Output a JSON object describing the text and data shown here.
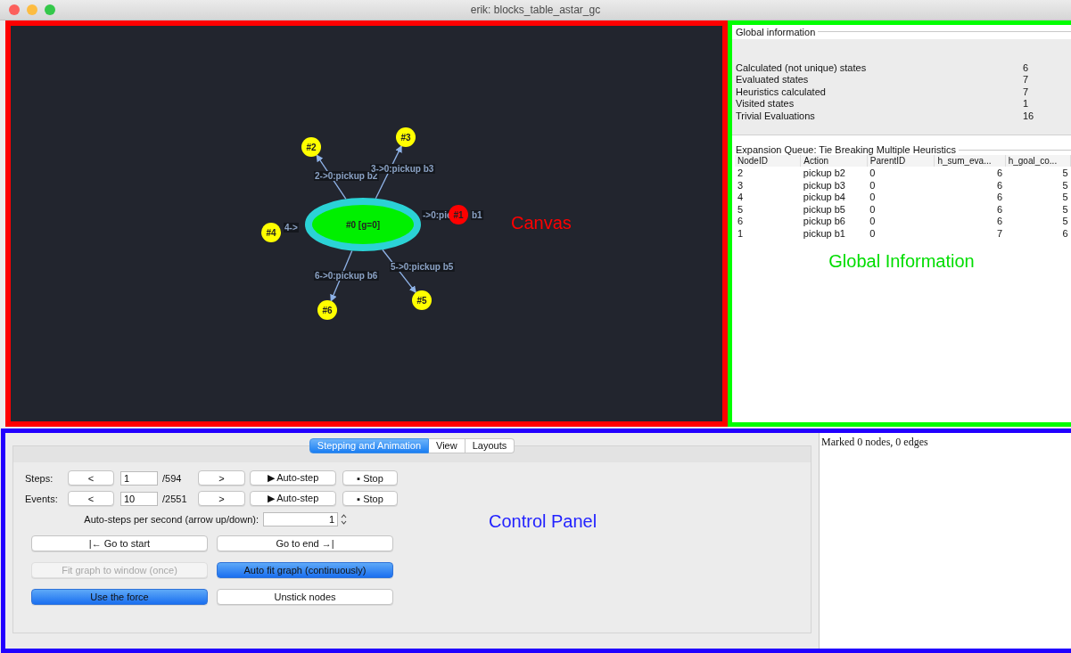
{
  "window": {
    "title": "erik: blocks_table_astar_gc"
  },
  "canvas": {
    "annotation": "Canvas",
    "root": {
      "label": "#0 [g=0]"
    },
    "nodes": [
      {
        "label": "#1",
        "color": "#ff0000"
      },
      {
        "label": "#2",
        "color": "#ffff00"
      },
      {
        "label": "#3",
        "color": "#ffff00"
      },
      {
        "label": "#4",
        "color": "#ffff00"
      },
      {
        "label": "#5",
        "color": "#ffff00"
      },
      {
        "label": "#6",
        "color": "#ffff00"
      }
    ],
    "edges": [
      {
        "label_parts": [
          "->0:pic",
          "b1"
        ]
      },
      {
        "label_parts": [
          "2->0:pickup b2"
        ]
      },
      {
        "label_parts": [
          "3->0:pickup b3"
        ]
      },
      {
        "label_parts": [
          "4->"
        ]
      },
      {
        "label_parts": [
          "5->0:pickup b5"
        ]
      },
      {
        "label_parts": [
          "6->0:pickup b6"
        ]
      }
    ]
  },
  "global_information": {
    "title": "Global information",
    "annotation": "Global Information",
    "stats": [
      {
        "label": "Calculated (not unique) states",
        "value": "6"
      },
      {
        "label": "Evaluated states",
        "value": "7"
      },
      {
        "label": "Heuristics calculated",
        "value": "7"
      },
      {
        "label": "Visited states",
        "value": "1"
      },
      {
        "label": "Trivial Evaluations",
        "value": "16"
      }
    ]
  },
  "expansion_queue": {
    "title": "Expansion Queue: Tie Breaking Multiple Heuristics",
    "columns": [
      "NodeID",
      "Action",
      "ParentID",
      "h_sum_eva...",
      "h_goal_co..."
    ],
    "rows": [
      [
        "2",
        "pickup b2",
        "0",
        "6",
        "5"
      ],
      [
        "3",
        "pickup b3",
        "0",
        "6",
        "5"
      ],
      [
        "4",
        "pickup b4",
        "0",
        "6",
        "5"
      ],
      [
        "5",
        "pickup b5",
        "0",
        "6",
        "5"
      ],
      [
        "6",
        "pickup b6",
        "0",
        "6",
        "5"
      ],
      [
        "1",
        "pickup b1",
        "0",
        "7",
        "6"
      ]
    ]
  },
  "control_panel": {
    "annotation": "Control Panel",
    "tabs": [
      {
        "label": "Stepping and Animation",
        "selected": true
      },
      {
        "label": "View",
        "selected": false
      },
      {
        "label": "Layouts",
        "selected": false
      }
    ],
    "rows": [
      {
        "kind": "stepper",
        "label": "Steps:",
        "prev": "<",
        "value": "1",
        "total": "/594",
        "next": ">",
        "auto": "▶ Auto-step",
        "stop": "▪ Stop"
      },
      {
        "kind": "stepper",
        "label": "Events:",
        "prev": "<",
        "value": "10",
        "total": "/2551",
        "next": ">",
        "auto": "▶ Auto-step",
        "stop": "▪ Stop"
      },
      {
        "kind": "spinner",
        "label": "Auto-steps per second (arrow up/down):",
        "value": "1"
      },
      {
        "kind": "buttons",
        "buttons": [
          {
            "label": "|←  Go to start",
            "disabled": false,
            "on": false
          },
          {
            "label": "Go to end  →|",
            "disabled": false,
            "on": false
          }
        ]
      },
      {
        "kind": "buttons",
        "buttons": [
          {
            "label": "Fit graph to window (once)",
            "disabled": true,
            "on": false
          },
          {
            "label": "Auto fit graph (continuously)",
            "disabled": false,
            "on": true
          }
        ]
      },
      {
        "kind": "buttons",
        "buttons": [
          {
            "label": "Use the force",
            "disabled": false,
            "on": true
          },
          {
            "label": "Unstick nodes",
            "disabled": false,
            "on": false
          }
        ]
      }
    ]
  },
  "marked_panel": {
    "text": "Marked 0 nodes, 0 edges"
  }
}
